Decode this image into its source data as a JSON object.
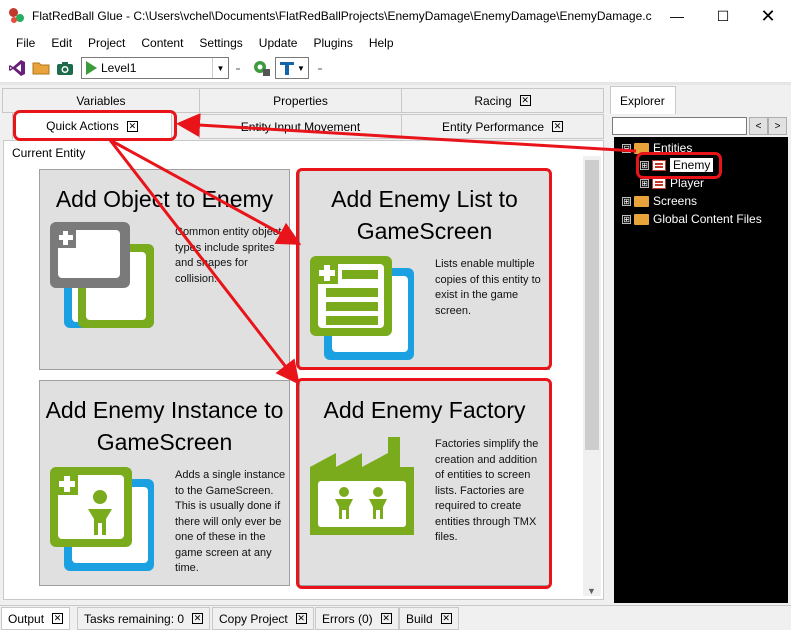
{
  "window": {
    "title": "FlatRedBall Glue - C:\\Users\\vchel\\Documents\\FlatRedBallProjects\\EnemyDamage\\EnemyDamage\\EnemyDamage.c...",
    "minimize": "—",
    "maximize": "☐",
    "close": "✕"
  },
  "menu": [
    "File",
    "Edit",
    "Project",
    "Content",
    "Settings",
    "Update",
    "Plugins",
    "Help"
  ],
  "toolbar": {
    "screen_combo_value": "Level1",
    "icons": [
      "visual-studio-icon",
      "folder-icon",
      "camera-icon",
      "play-icon",
      "gear-icon",
      "text-tool-icon"
    ]
  },
  "tabs_row1": [
    {
      "label": "Variables",
      "closable": false
    },
    {
      "label": "Properties",
      "closable": false
    },
    {
      "label": "Racing",
      "closable": true
    }
  ],
  "tabs_row2": [
    {
      "label": "Quick Actions",
      "closable": true,
      "active": true
    },
    {
      "label": "Entity Input Movement",
      "closable": false
    },
    {
      "label": "Entity Performance",
      "closable": true
    }
  ],
  "main": {
    "current_entity_label": "Current Entity",
    "cards": [
      {
        "title": "Add Object to Enemy",
        "desc": "Common entity object types include sprites and shapes for collision.",
        "highlighted": false
      },
      {
        "title_line1": "Add Enemy List to",
        "title_line2": "GameScreen",
        "desc": "Lists enable multiple copies of this entity to exist in the game screen.",
        "highlighted": true
      },
      {
        "title_line1": "Add Enemy Instance to",
        "title_line2": "GameScreen",
        "desc": "Adds a single instance to the GameScreen. This is usually done if there will only ever be one of these in the game screen at any time.",
        "highlighted": false
      },
      {
        "title": "Add Enemy Factory",
        "desc": "Factories simplify the creation and addition of entities to screen lists. Factories are required to create entities through TMX files.",
        "highlighted": true
      }
    ]
  },
  "explorer": {
    "tab_label": "Explorer",
    "search_value": "",
    "back_label": "<",
    "forward_label": ">",
    "tree": [
      {
        "label": "Entities",
        "expander": "⊟",
        "level": 0
      },
      {
        "label": "Enemy",
        "expander": "⊞",
        "level": 1,
        "selected": true
      },
      {
        "label": "Player",
        "expander": "⊞",
        "level": 1
      },
      {
        "label": "Screens",
        "expander": "⊞",
        "level": 0
      },
      {
        "label": "Global Content Files",
        "expander": "⊞",
        "level": 0
      }
    ]
  },
  "bottom_tabs": [
    {
      "label": "Output",
      "active": true
    },
    {
      "label": "Tasks remaining: 0"
    },
    {
      "label": "Copy Project"
    },
    {
      "label": "Errors (0)"
    },
    {
      "label": "Build"
    }
  ],
  "colors": {
    "annotation_red": "#e8141a",
    "icon_green": "#7aab1d",
    "icon_blue": "#1ba1e2",
    "icon_gray": "#7a7a7a"
  }
}
